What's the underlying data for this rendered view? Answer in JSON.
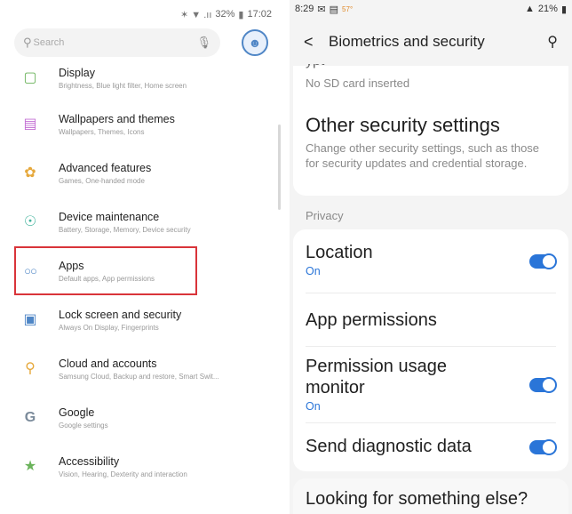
{
  "left": {
    "status": {
      "indicators": "✶ ▼ .ıı",
      "battery_text": "32%",
      "time": "17:02"
    },
    "search": {
      "placeholder": "Search"
    },
    "items": [
      {
        "title": "Display",
        "subtitle": "Brightness, Blue light filter, Home screen",
        "icon": "display-icon",
        "color": "#6bb35b"
      },
      {
        "title": "Wallpapers and themes",
        "subtitle": "Wallpapers, Themes, Icons",
        "icon": "wallpaper-icon",
        "color": "#c36fd4"
      },
      {
        "title": "Advanced features",
        "subtitle": "Games, One-handed mode",
        "icon": "advanced-features-icon",
        "color": "#e6a83b"
      },
      {
        "title": "Device maintenance",
        "subtitle": "Battery, Storage, Memory, Device security",
        "icon": "device-maintenance-icon",
        "color": "#3fb29b"
      },
      {
        "title": "Apps",
        "subtitle": "Default apps, App permissions",
        "icon": "apps-icon",
        "color": "#4f86c6"
      },
      {
        "title": "Lock screen and security",
        "subtitle": "Always On Display, Fingerprints",
        "icon": "lock-icon",
        "color": "#4f86c6"
      },
      {
        "title": "Cloud and accounts",
        "subtitle": "Samsung Cloud, Backup and restore, Smart Swit...",
        "icon": "key-icon",
        "color": "#e6a83b"
      },
      {
        "title": "Google",
        "subtitle": "Google settings",
        "icon": "google-icon",
        "color": "#7a8a9a"
      },
      {
        "title": "Accessibility",
        "subtitle": "Vision, Hearing, Dexterity and interaction",
        "icon": "accessibility-icon",
        "color": "#6bb35b"
      }
    ]
  },
  "right": {
    "status": {
      "time": "8:29",
      "temp": "57°",
      "battery": "21%"
    },
    "header": {
      "title": "Biometrics and security"
    },
    "card1": {
      "sd_text": "No SD card inserted",
      "title": "Other security settings",
      "desc": "Change other security settings, such as those for security updates and credential storage."
    },
    "privacy_label": "Privacy",
    "rows": {
      "location": {
        "title": "Location",
        "status": "On",
        "on": true
      },
      "app_permissions": {
        "title": "App permissions"
      },
      "permission_monitor": {
        "title": "Permission usage monitor",
        "status": "On",
        "on": true
      },
      "diagnostic": {
        "title": "Send diagnostic data",
        "on": true
      }
    },
    "card3": {
      "title": "Looking for something else?"
    },
    "accent": "#2a75d8"
  }
}
